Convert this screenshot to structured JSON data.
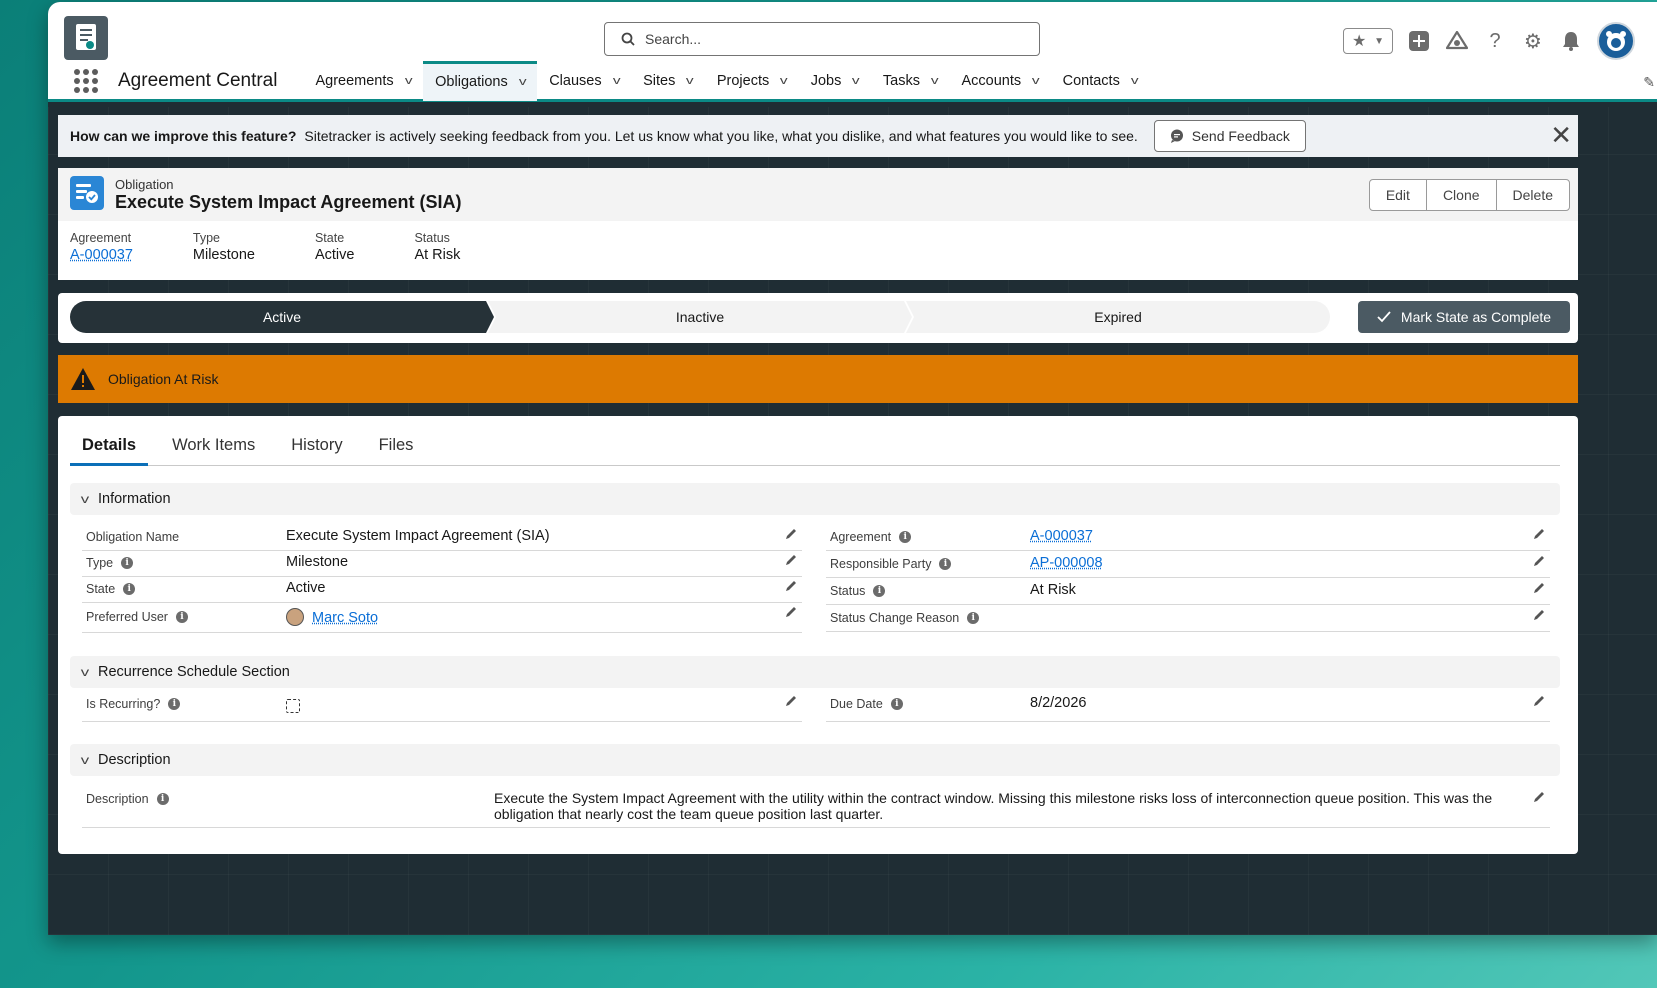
{
  "header": {
    "search_placeholder": "Search...",
    "app_name": "Agreement Central"
  },
  "nav": [
    {
      "label": "Agreements",
      "active": false
    },
    {
      "label": "Obligations",
      "active": true
    },
    {
      "label": "Clauses",
      "active": false
    },
    {
      "label": "Sites",
      "active": false
    },
    {
      "label": "Projects",
      "active": false
    },
    {
      "label": "Jobs",
      "active": false
    },
    {
      "label": "Tasks",
      "active": false
    },
    {
      "label": "Accounts",
      "active": false
    },
    {
      "label": "Contacts",
      "active": false
    }
  ],
  "feedback": {
    "question": "How can we improve this feature?",
    "message": "Sitetracker is actively seeking feedback from you. Let us know what you like, what you dislike, and what features you would like to see.",
    "button": "Send Feedback"
  },
  "record": {
    "kind": "Obligation",
    "title": "Execute System Impact Agreement (SIA)",
    "actions": [
      "Edit",
      "Clone",
      "Delete"
    ],
    "highlights": [
      {
        "label": "Agreement",
        "value": "A-000037",
        "link": true
      },
      {
        "label": "Type",
        "value": "Milestone",
        "link": false
      },
      {
        "label": "State",
        "value": "Active",
        "link": false
      },
      {
        "label": "Status",
        "value": "At Risk",
        "link": false
      }
    ]
  },
  "path": {
    "stages": [
      {
        "label": "Active",
        "current": true
      },
      {
        "label": "Inactive",
        "current": false
      },
      {
        "label": "Expired",
        "current": false
      }
    ],
    "complete_button": "Mark State as Complete"
  },
  "alert": {
    "text": "Obligation At Risk"
  },
  "tabs": [
    {
      "label": "Details",
      "active": true
    },
    {
      "label": "Work Items",
      "active": false
    },
    {
      "label": "History",
      "active": false
    },
    {
      "label": "Files",
      "active": false
    }
  ],
  "sections": {
    "information": "Information",
    "recurrence": "Recurrence Schedule Section",
    "description": "Description"
  },
  "fields": {
    "obligation_name": {
      "label": "Obligation Name",
      "value": "Execute System Impact Agreement (SIA)"
    },
    "type": {
      "label": "Type",
      "value": "Milestone"
    },
    "state": {
      "label": "State",
      "value": "Active"
    },
    "preferred_user": {
      "label": "Preferred User",
      "value": "Marc Soto"
    },
    "agreement": {
      "label": "Agreement",
      "value": "A-000037"
    },
    "responsible_party": {
      "label": "Responsible Party",
      "value": "AP-000008"
    },
    "status": {
      "label": "Status",
      "value": "At Risk"
    },
    "status_change_reason": {
      "label": "Status Change Reason",
      "value": ""
    },
    "is_recurring": {
      "label": "Is Recurring?",
      "checked": false
    },
    "due_date": {
      "label": "Due Date",
      "value": "8/2/2026"
    },
    "description": {
      "label": "Description",
      "value": "Execute the System Impact Agreement with the utility within the contract window. Missing this milestone risks loss of interconnection queue position. This was the obligation that nearly cost the team queue position last quarter."
    }
  },
  "colors": {
    "accent": "#0b8a86",
    "alert": "#dd7a01",
    "path_current": "#263238",
    "link": "#0a6ed6"
  }
}
